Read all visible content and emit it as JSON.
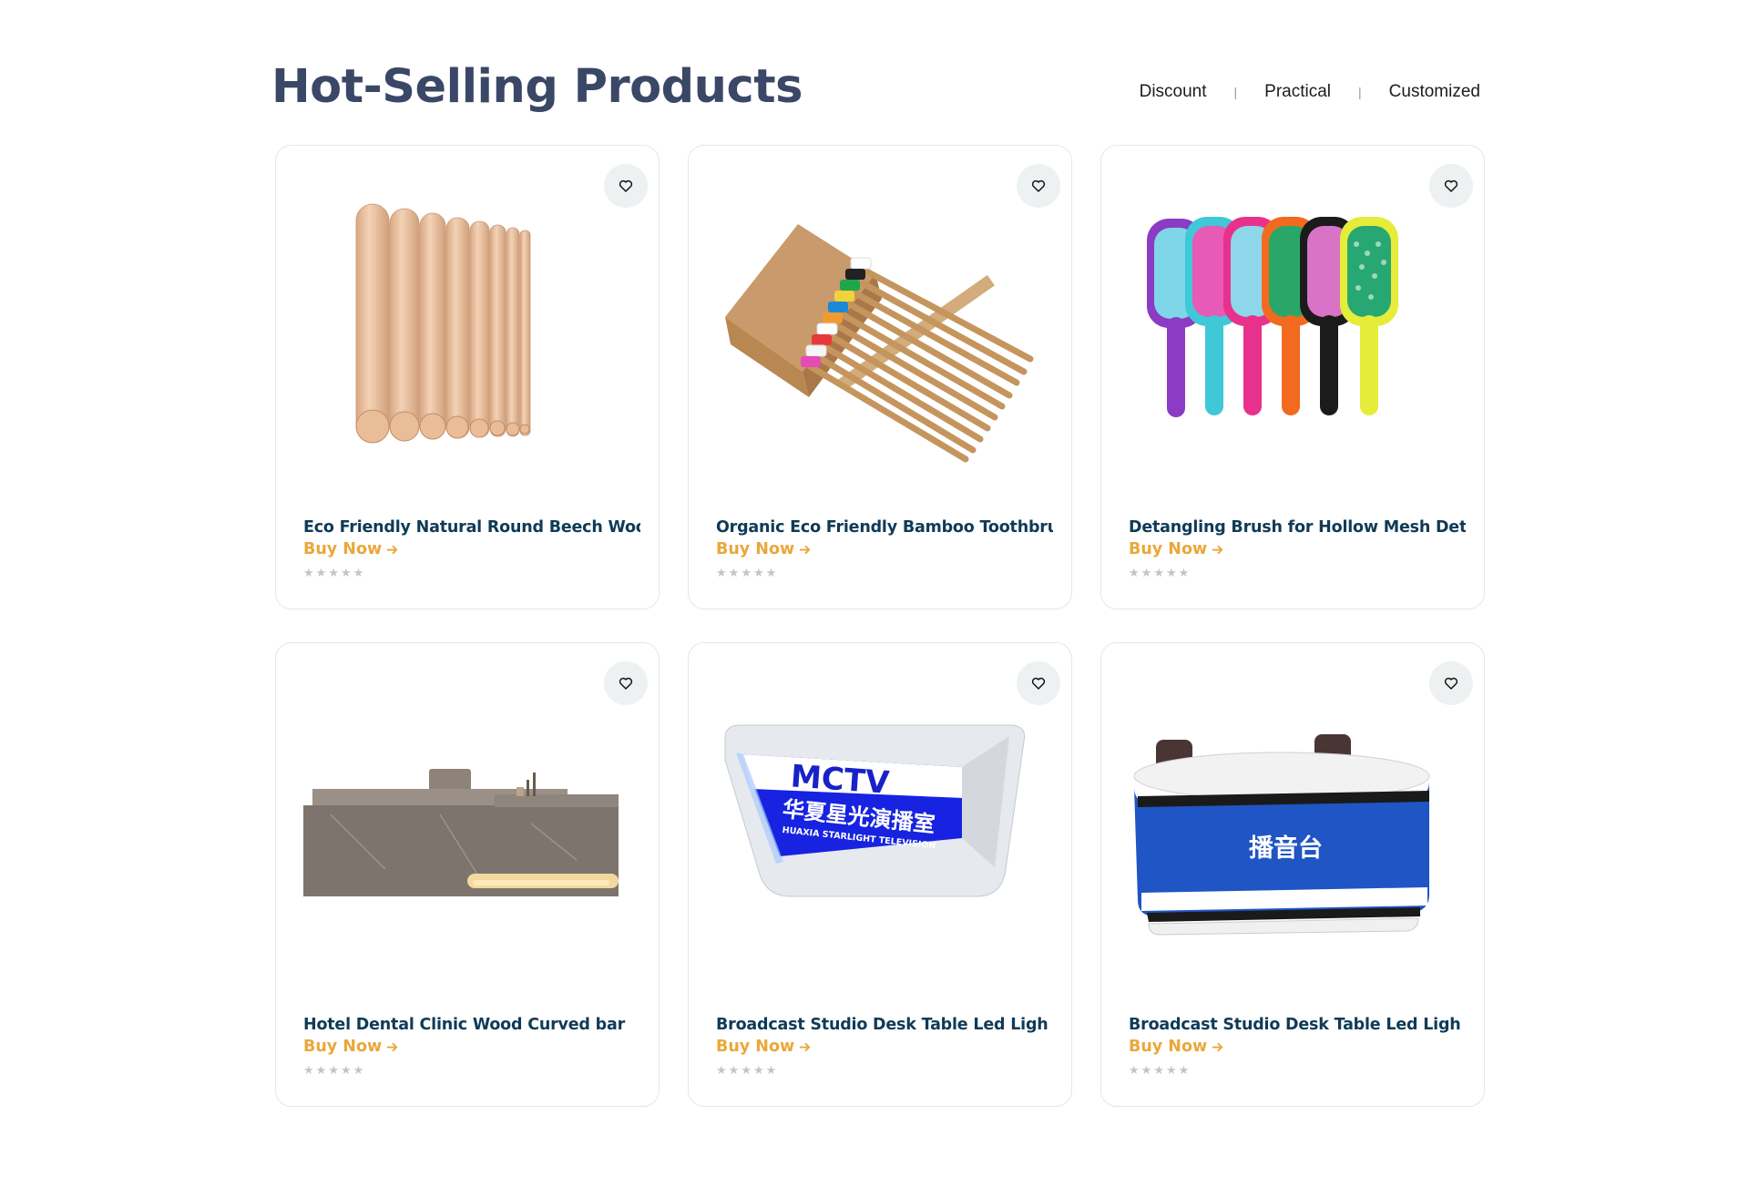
{
  "header": {
    "title": "Hot-Selling Products",
    "filters": [
      "Discount",
      "Practical",
      "Customized"
    ],
    "separator": "|"
  },
  "products": [
    {
      "name": "Eco Friendly Natural Round Beech Woo",
      "cta": "Buy Now",
      "rating": 0,
      "image": "wooden-dowels"
    },
    {
      "name": "Organic Eco Friendly Bamboo Toothbru",
      "cta": "Buy Now",
      "rating": 0,
      "image": "bamboo-toothbrushes"
    },
    {
      "name": "Detangling Brush for Hollow Mesh Det",
      "cta": "Buy Now",
      "rating": 0,
      "image": "hair-brushes"
    },
    {
      "name": "Hotel Dental Clinic Wood Curved bar",
      "cta": "Buy Now",
      "rating": 0,
      "image": "reception-bar"
    },
    {
      "name": "Broadcast Studio Desk Table Led Ligh",
      "cta": "Buy Now",
      "rating": 0,
      "image": "mctv-desk",
      "image_text": [
        "MCTV",
        "华夏星光演播室",
        "HUAXIA STARLIGHT TELEVISION"
      ]
    },
    {
      "name": "Broadcast Studio Desk Table Led Ligh",
      "cta": "Buy Now",
      "rating": 0,
      "image": "anchor-desk",
      "image_text": [
        "播音台"
      ]
    }
  ],
  "colors": {
    "title": "#3a4766",
    "product_name": "#0f3b57",
    "cta": "#e9a83a",
    "star_empty": "#c4c4c4"
  },
  "icons": {
    "favorite": "heart-icon",
    "cta": "arrow-right-icon",
    "rating": "star-icon"
  }
}
